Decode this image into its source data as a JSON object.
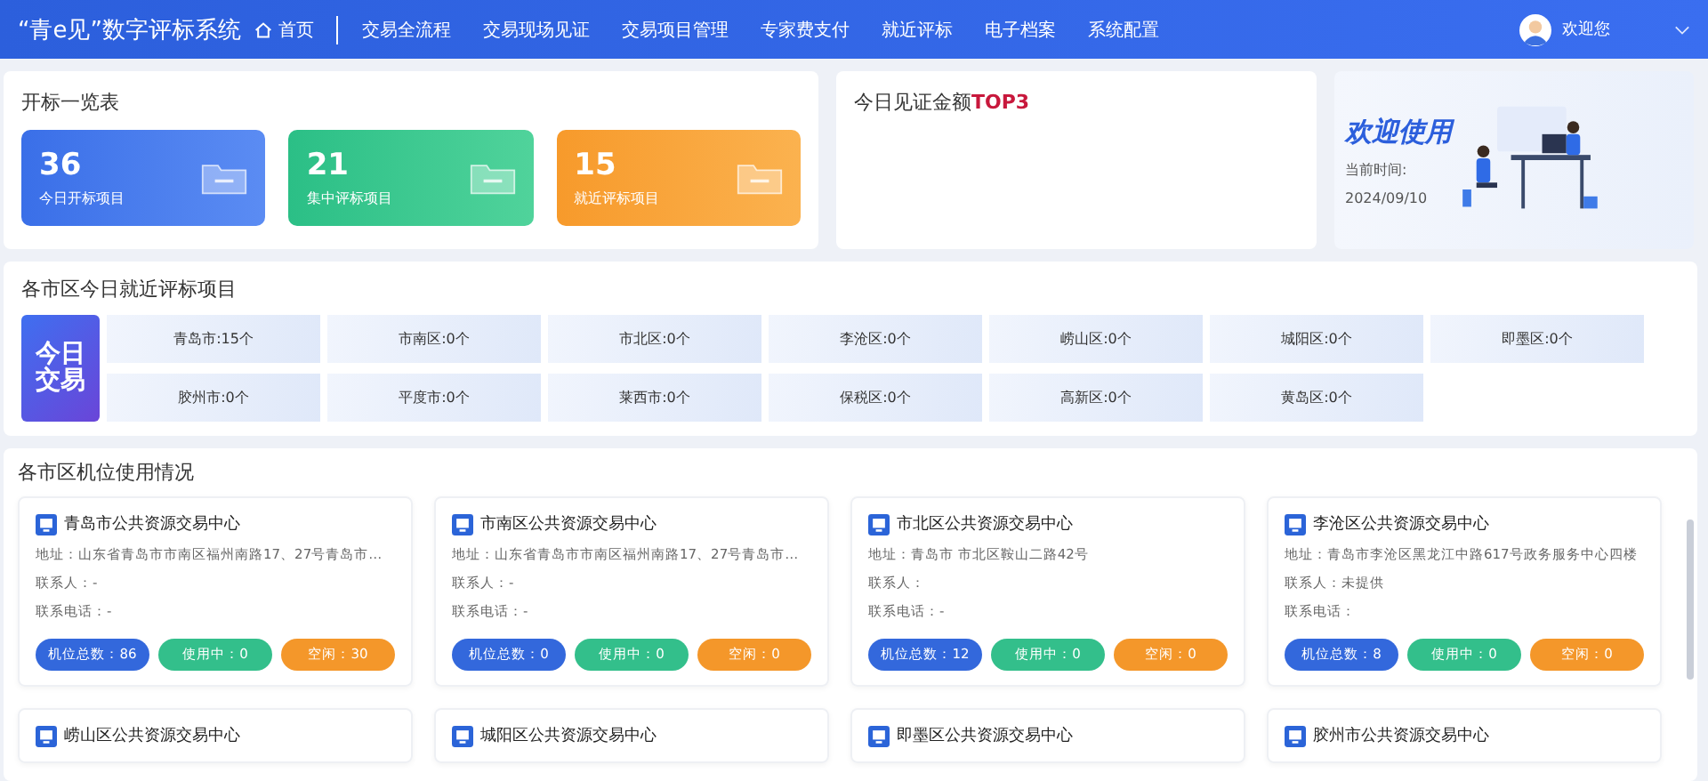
{
  "header": {
    "brand": "“青e见”数字评标系统",
    "nav": [
      {
        "label": "首页",
        "kind": "home"
      },
      {
        "label": "交易全流程",
        "kind": "text"
      },
      {
        "label": "交易现场见证",
        "kind": "text"
      },
      {
        "label": "交易项目管理",
        "kind": "text"
      },
      {
        "label": "专家费支付",
        "kind": "text"
      },
      {
        "label": "就近评标",
        "kind": "text"
      },
      {
        "label": "电子档案",
        "kind": "text"
      },
      {
        "label": "系统配置",
        "kind": "text"
      }
    ],
    "user": "欢迎您"
  },
  "overview": {
    "title": "开标一览表",
    "stats": [
      {
        "value": "36",
        "label": "今日开标项目",
        "kind": "blue"
      },
      {
        "value": "21",
        "label": "集中评标项目",
        "kind": "green"
      },
      {
        "value": "15",
        "label": "就近评标项目",
        "kind": "orange"
      }
    ]
  },
  "top3": {
    "title": "今日见证金额",
    "highlight": "TOP3"
  },
  "welcome": {
    "title": "欢迎使用",
    "time_label": "当前时间:",
    "date": "2024/09/10"
  },
  "districts": {
    "title": "各市区今日就近评标项目",
    "badge": [
      "今日",
      "交易"
    ],
    "items": [
      "青岛市:15个",
      "市南区:0个",
      "市北区:0个",
      "李沧区:0个",
      "崂山区:0个",
      "城阳区:0个",
      "即墨区:0个",
      "胶州市:0个",
      "平度市:0个",
      "莱西市:0个",
      "保税区:0个",
      "高新区:0个",
      "黄岛区:0个"
    ]
  },
  "seats": {
    "title": "各市区机位使用情况",
    "centers": [
      {
        "name": "青岛市公共资源交易中心",
        "address": "地址：山东省青岛市市南区福州南路17、27号青岛市…",
        "contact": "联系人：-",
        "phone": "联系电话：-",
        "pills": [
          {
            "kind": "total",
            "text": "机位总数：86"
          },
          {
            "kind": "using",
            "text": "使用中：0"
          },
          {
            "kind": "free",
            "text": "空闲：30"
          }
        ]
      },
      {
        "name": "市南区公共资源交易中心",
        "address": "地址：山东省青岛市市南区福州南路17、27号青岛市…",
        "contact": "联系人：-",
        "phone": "联系电话：-",
        "pills": [
          {
            "kind": "total",
            "text": "机位总数：0"
          },
          {
            "kind": "using",
            "text": "使用中：0"
          },
          {
            "kind": "free",
            "text": "空闲：0"
          }
        ]
      },
      {
        "name": "市北区公共资源交易中心",
        "address": "地址：青岛市 市北区鞍山二路42号",
        "contact": "联系人：",
        "phone": "联系电话：-",
        "pills": [
          {
            "kind": "total",
            "text": "机位总数：12"
          },
          {
            "kind": "using",
            "text": "使用中：0"
          },
          {
            "kind": "free",
            "text": "空闲：0"
          }
        ]
      },
      {
        "name": "李沧区公共资源交易中心",
        "address": "地址：青岛市李沧区黑龙江中路617号政务服务中心四楼",
        "contact": "联系人：未提供",
        "phone": "联系电话：",
        "pills": [
          {
            "kind": "total",
            "text": "机位总数：8"
          },
          {
            "kind": "using",
            "text": "使用中：0"
          },
          {
            "kind": "free",
            "text": "空闲：0"
          }
        ]
      },
      {
        "name": "崂山区公共资源交易中心"
      },
      {
        "name": "城阳区公共资源交易中心"
      },
      {
        "name": "即墨区公共资源交易中心"
      },
      {
        "name": "胶州市公共资源交易中心"
      }
    ]
  }
}
